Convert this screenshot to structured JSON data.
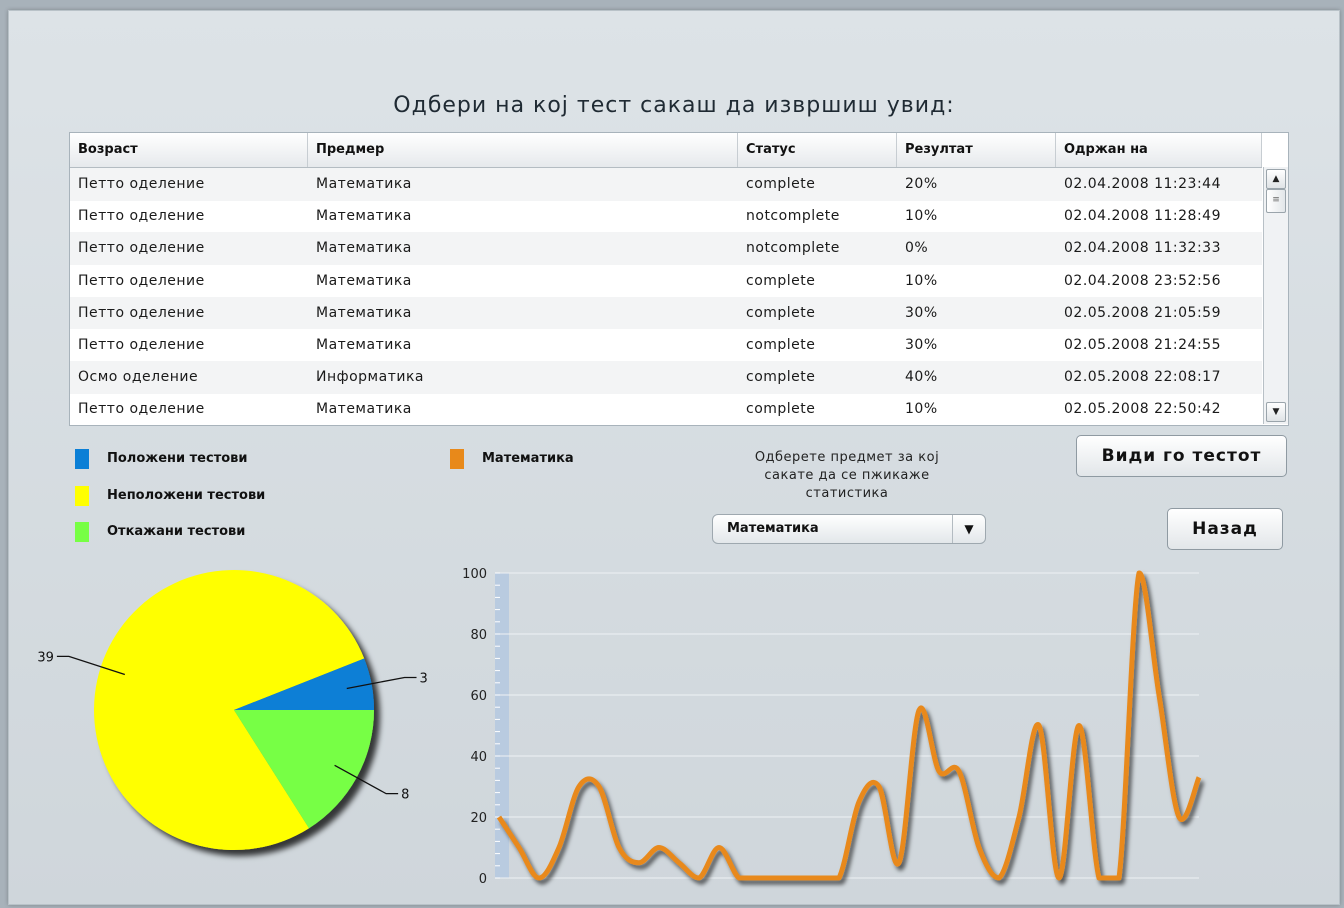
{
  "page": {
    "title": "Одбери на кој тест сакаш да извршиш увид:"
  },
  "table": {
    "columns": [
      "Возраст",
      "Предмер",
      "Статус",
      "Резултат",
      "Одржан на"
    ],
    "rows": [
      [
        "Петто оделение",
        "Математика",
        "complete",
        "20%",
        "02.04.2008 11:23:44"
      ],
      [
        "Петто оделение",
        "Математика",
        "notcomplete",
        "10%",
        "02.04.2008 11:28:49"
      ],
      [
        "Петто оделение",
        "Математика",
        "notcomplete",
        "0%",
        "02.04.2008 11:32:33"
      ],
      [
        "Петто оделение",
        "Математика",
        "complete",
        "10%",
        "02.04.2008 23:52:56"
      ],
      [
        "Петто оделение",
        "Математика",
        "complete",
        "30%",
        "02.05.2008 21:05:59"
      ],
      [
        "Петто оделение",
        "Математика",
        "complete",
        "30%",
        "02.05.2008 21:24:55"
      ],
      [
        "Осмо оделение",
        "Информатика",
        "complete",
        "40%",
        "02.05.2008 22:08:17"
      ],
      [
        "Петто оделение",
        "Математика",
        "complete",
        "10%",
        "02.05.2008 22:50:42"
      ]
    ]
  },
  "legend": {
    "passed": "Положени тестови",
    "failed": "Неположени тестови",
    "abandoned": "Откажани тестови",
    "subject": "Математика"
  },
  "controls": {
    "select_caption_line1": "Одберете предмет за кој",
    "select_caption_line2": "сакате да се пжикаже",
    "select_caption_line3": "статистика",
    "select_value": "Математика",
    "view_test_button": "Види го тестот",
    "back_button": "Назад"
  },
  "colors": {
    "passed": "#0b7fd6",
    "failed": "#ffff00",
    "abandoned": "#77ff44",
    "line": "#e8891a"
  },
  "chart_data": [
    {
      "type": "pie",
      "labels": [
        "Положени тестови",
        "Неположени тестови",
        "Откажани тестови"
      ],
      "values": [
        3,
        39,
        8
      ],
      "data_labels": [
        "3",
        "39",
        "8"
      ]
    },
    {
      "type": "line",
      "series": [
        {
          "name": "Математика",
          "values": [
            20,
            10,
            0,
            10,
            30,
            30,
            10,
            5,
            10,
            5,
            0,
            10,
            0,
            0,
            0,
            0,
            0,
            0,
            25,
            30,
            5,
            55,
            35,
            35,
            10,
            0,
            20,
            50,
            0,
            50,
            0,
            0,
            100,
            60,
            20,
            33
          ]
        }
      ],
      "ylim": [
        0,
        100
      ],
      "yticks": [
        0,
        20,
        40,
        60,
        80,
        100
      ],
      "grid": true
    }
  ]
}
